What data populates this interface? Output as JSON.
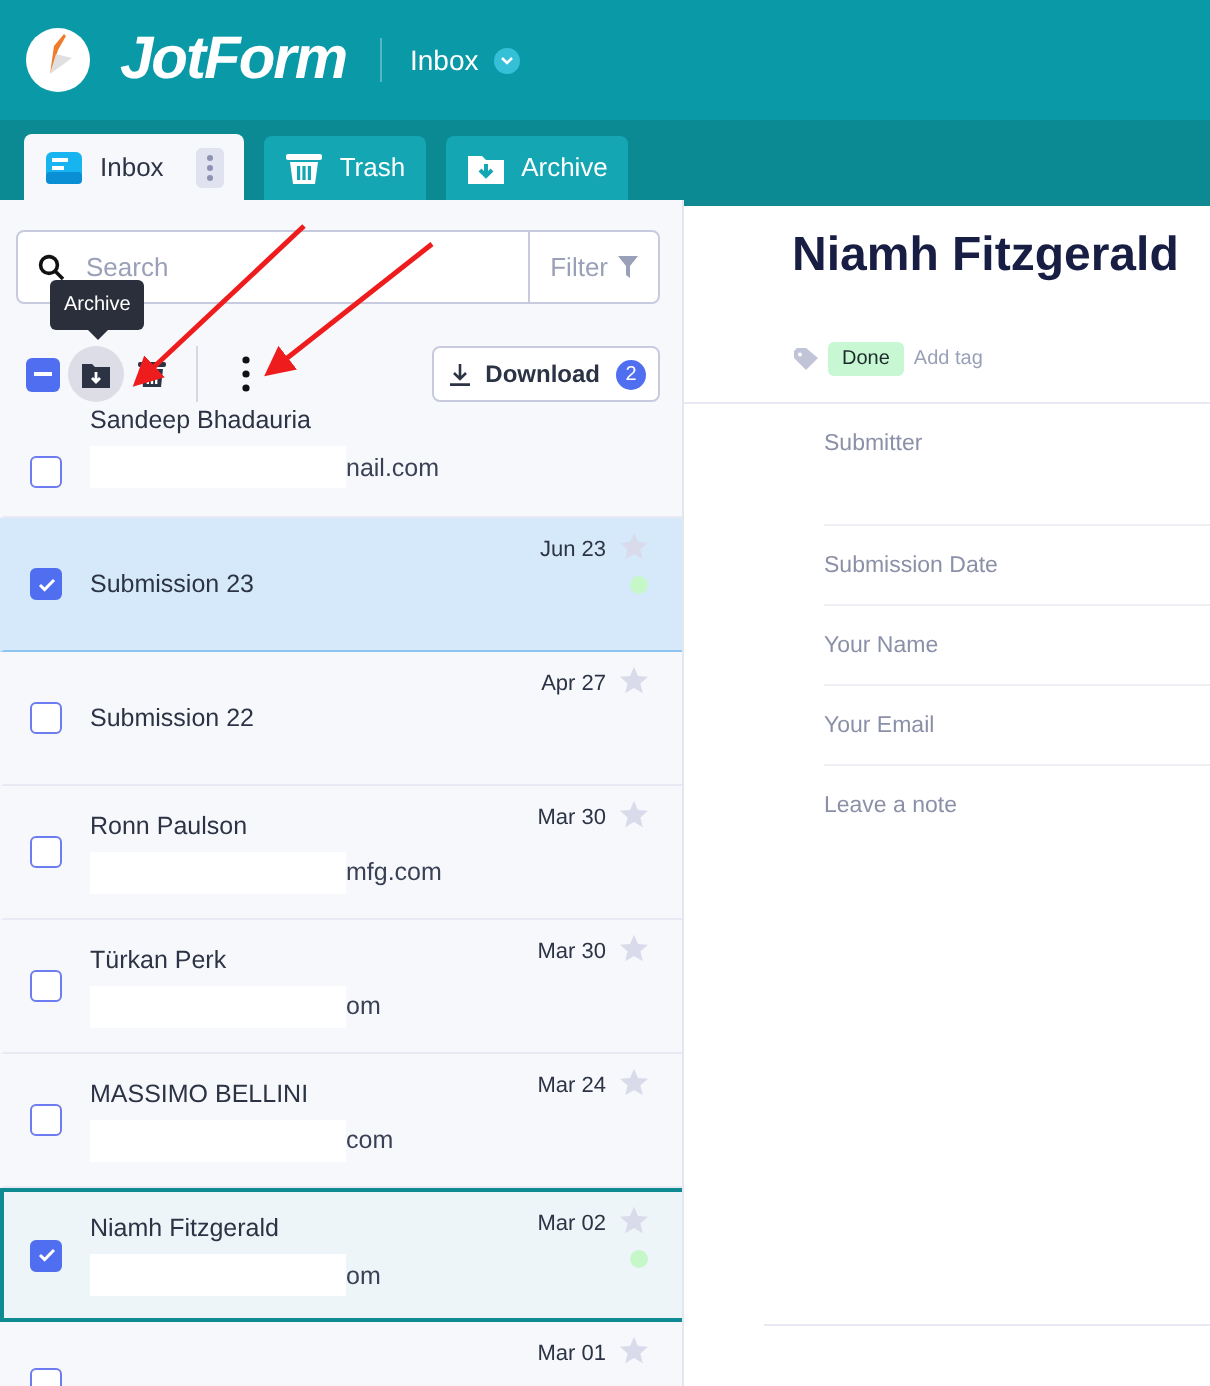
{
  "header": {
    "logo": "JotForm",
    "form_menu": "Inbox"
  },
  "tabs": [
    {
      "label": "Inbox",
      "selected": true,
      "menu": true
    },
    {
      "label": "Trash",
      "selected": false,
      "menu": false
    },
    {
      "label": "Archive",
      "selected": false,
      "menu": false
    }
  ],
  "search": {
    "placeholder": "Search"
  },
  "filter": "Filter",
  "toolbar": {
    "select_all_indeterminate": true,
    "tooltip": "Archive",
    "download": "Download",
    "download_count": "2"
  },
  "submissions": [
    {
      "name": "Sandeep Bhadauria",
      "email": "nail.com",
      "checked": false,
      "dot": false,
      "hovered": false,
      "opened": false,
      "redacted": true
    },
    {
      "name": "Submission 23",
      "date": "Jun 23",
      "checked": true,
      "dot": true,
      "hovered": true,
      "opened": false,
      "redacted": false
    },
    {
      "name": "Submission 22",
      "date": "Apr 27",
      "checked": false,
      "dot": false,
      "hovered": false,
      "opened": false,
      "redacted": false
    },
    {
      "name": "Ronn Paulson",
      "email": "mfg.com",
      "date": "Mar 30",
      "checked": false,
      "dot": false,
      "hovered": false,
      "opened": false,
      "redacted": true
    },
    {
      "name": "Türkan Perk",
      "email": "om",
      "date": "Mar 30",
      "checked": false,
      "dot": false,
      "hovered": false,
      "opened": false,
      "redacted": true
    },
    {
      "name": "MASSIMO BELLINI",
      "email": "com",
      "date": "Mar 24",
      "checked": false,
      "dot": false,
      "hovered": false,
      "opened": false,
      "redacted": true
    },
    {
      "name": "Niamh Fitzgerald",
      "email": "om",
      "date": "Mar 02",
      "checked": true,
      "dot": true,
      "hovered": false,
      "opened": true,
      "redacted": true
    },
    {
      "date": "Mar 01",
      "checked": false,
      "dot": false,
      "hovered": false,
      "opened": false,
      "redacted": false
    }
  ],
  "detail": {
    "title": "Niamh Fitzgerald",
    "tags": [
      {
        "label": "Done",
        "color": "#c8f7d4"
      }
    ],
    "add_tag": "Add tag",
    "fields": [
      "Submitter",
      "Submission Date",
      "Your Name",
      "Your Email",
      "Leave a note"
    ]
  }
}
